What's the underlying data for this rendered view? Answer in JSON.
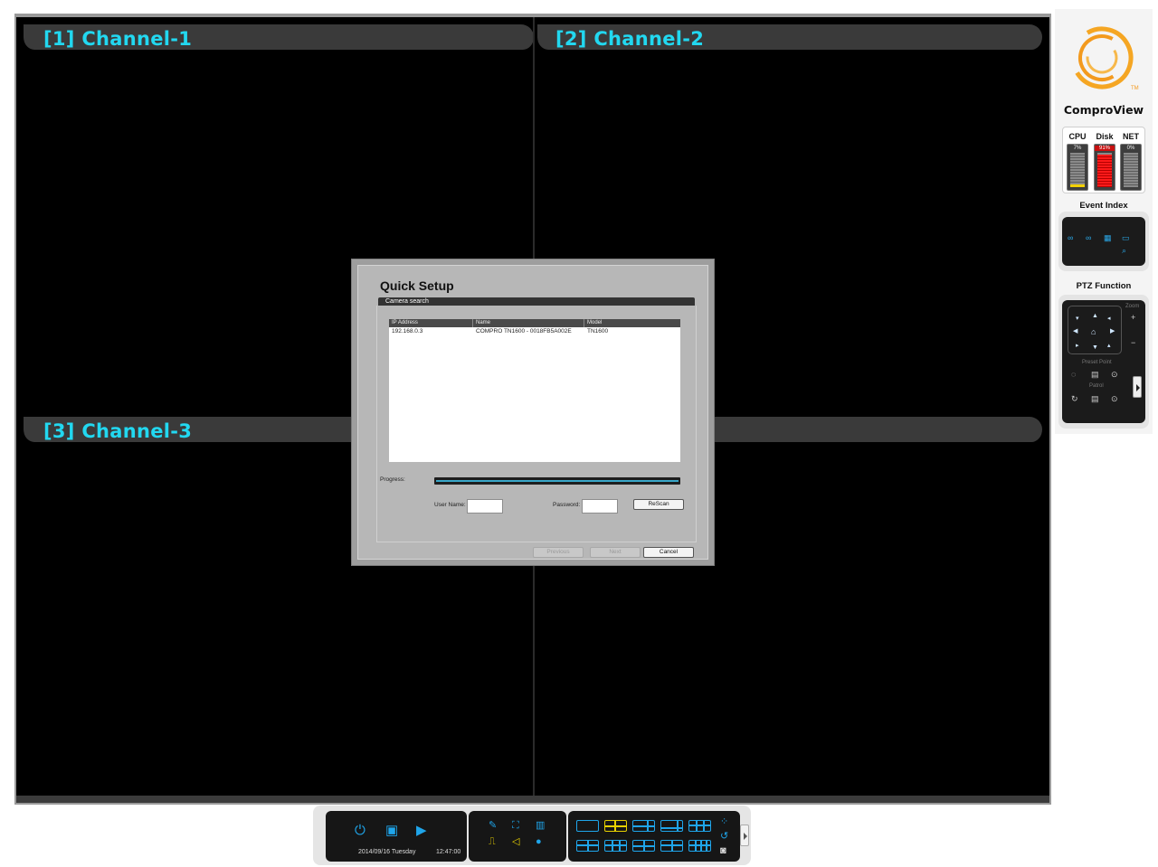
{
  "channels": [
    {
      "label": "[1] Channel-1"
    },
    {
      "label": "[2] Channel-2"
    },
    {
      "label": "[3] Channel-3"
    }
  ],
  "dialog": {
    "title": "Quick Setup",
    "section": "Camera search",
    "columns": [
      "IP Address",
      "Name",
      "Model"
    ],
    "rows": [
      {
        "ip": "192.168.0.3",
        "name": "COMPRO TN1600 - 0018FB5A002E",
        "model": "TN1600"
      }
    ],
    "progress_label": "Progress:",
    "progress_fraction": 1.0,
    "username_label": "User Name:",
    "username_value": "",
    "password_label": "Password:",
    "password_value": "",
    "rescan_label": "ReScan",
    "previous_label": "Previous",
    "next_label": "Next",
    "cancel_label": "Cancel"
  },
  "sidebar": {
    "logo_icon": "comproview-swirl-logo",
    "tm_mark": "TM",
    "brand": "ComproView",
    "meters": [
      {
        "label": "CPU",
        "value": "7%",
        "level": 0.07
      },
      {
        "label": "Disk",
        "value": "91%",
        "level": 0.91
      },
      {
        "label": "NET",
        "value": "0%",
        "level": 0.0
      }
    ],
    "event_index": "Event Index",
    "ptz": {
      "title": "PTZ Function",
      "zoom": "Zoom",
      "zoom_in": "+",
      "zoom_out": "−",
      "preset": "Preset Point",
      "patrol": "Patrol"
    }
  },
  "toolbar": {
    "date": "2014/09/16 Tuesday",
    "time": "12:47:00",
    "icons": [
      "power-icon",
      "playback-icon",
      "play-icon",
      "settings-tools-icon",
      "snapshot-icon",
      "save-icon",
      "signal-icon",
      "speaker-icon",
      "chat-icon"
    ],
    "active_layout": 1
  },
  "colors": {
    "channel_title": "#22d8f0",
    "accent_blue": "#1fa5ea",
    "accent_yellow": "#e8d100",
    "disk_red": "#ff1a1a",
    "logo_orange": "#f39a1e"
  }
}
